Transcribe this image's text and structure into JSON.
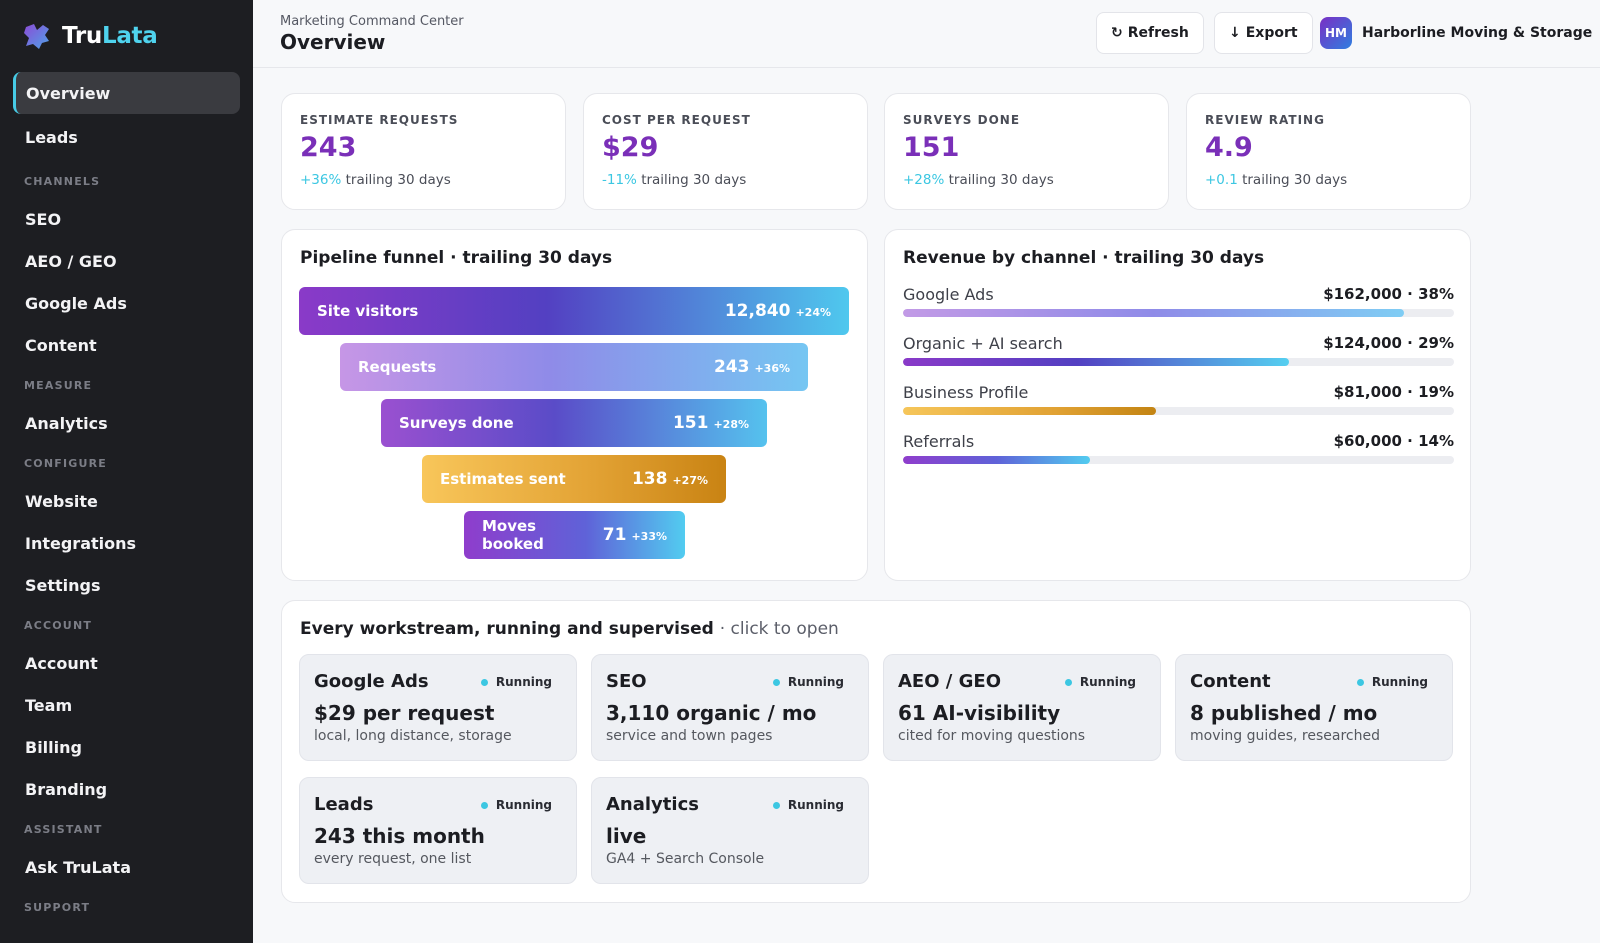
{
  "app": {
    "brand_part1": "Tru",
    "brand_part2": "Lata"
  },
  "sidebar": {
    "items": [
      {
        "label": "Overview",
        "active": true
      },
      {
        "label": "Leads"
      }
    ],
    "sections": [
      {
        "title": "CHANNELS",
        "items": [
          "SEO",
          "AEO / GEO",
          "Google Ads",
          "Content"
        ]
      },
      {
        "title": "MEASURE",
        "items": [
          "Analytics"
        ]
      },
      {
        "title": "CONFIGURE",
        "items": [
          "Website",
          "Integrations",
          "Settings"
        ]
      },
      {
        "title": "ACCOUNT",
        "items": [
          "Account",
          "Team",
          "Billing",
          "Branding"
        ]
      },
      {
        "title": "ASSISTANT",
        "items": [
          "Ask TruLata"
        ]
      },
      {
        "title": "SUPPORT",
        "items": []
      }
    ]
  },
  "header": {
    "eyebrow": "Marketing Command Center",
    "title": "Overview",
    "refresh_label": "Refresh",
    "export_label": "Export",
    "org_initials": "HM",
    "org_name": "Harborline Moving & Storage"
  },
  "kpis": [
    {
      "label": "ESTIMATE REQUESTS",
      "value": "243",
      "delta": "+36%",
      "sub": "trailing 30 days"
    },
    {
      "label": "COST PER REQUEST",
      "value": "$29",
      "delta": "-11%",
      "sub": "trailing 30 days"
    },
    {
      "label": "SURVEYS DONE",
      "value": "151",
      "delta": "+28%",
      "sub": "trailing 30 days"
    },
    {
      "label": "REVIEW RATING",
      "value": "4.9",
      "delta": "+0.1",
      "sub": "trailing 30 days"
    }
  ],
  "funnel": {
    "title": "Pipeline funnel · trailing 30 days",
    "stages": [
      {
        "label": "Site visitors",
        "value": "12,840",
        "delta": "+24%"
      },
      {
        "label": "Requests",
        "value": "243",
        "delta": "+36%"
      },
      {
        "label": "Surveys done",
        "value": "151",
        "delta": "+28%"
      },
      {
        "label": "Estimates sent",
        "value": "138",
        "delta": "+27%"
      },
      {
        "label": "Moves booked",
        "value": "71",
        "delta": "+33%"
      }
    ]
  },
  "revenue": {
    "title": "Revenue by channel · trailing 30 days",
    "rows": [
      {
        "name": "Google Ads",
        "amount": "$162,000 · 38%",
        "share": 0.91
      },
      {
        "name": "Organic + AI search",
        "amount": "$124,000 · 29%",
        "share": 0.7
      },
      {
        "name": "Business Profile",
        "amount": "$81,000 · 19%",
        "share": 0.46
      },
      {
        "name": "Referrals",
        "amount": "$60,000 · 14%",
        "share": 0.34
      }
    ]
  },
  "workstreams": {
    "title": "Every workstream, running and supervised",
    "hint": "· click to open",
    "items": [
      {
        "name": "Google Ads",
        "status": "Running",
        "metric": "$29 per request",
        "desc": "local, long distance, storage"
      },
      {
        "name": "SEO",
        "status": "Running",
        "metric": "3,110 organic / mo",
        "desc": "service and town pages"
      },
      {
        "name": "AEO / GEO",
        "status": "Running",
        "metric": "61 AI-visibility",
        "desc": "cited for moving questions"
      },
      {
        "name": "Content",
        "status": "Running",
        "metric": "8 published / mo",
        "desc": "moving guides, researched"
      },
      {
        "name": "Leads",
        "status": "Running",
        "metric": "243 this month",
        "desc": "every request, one list"
      },
      {
        "name": "Analytics",
        "status": "Running",
        "metric": "live",
        "desc": "GA4 + Search Console"
      }
    ]
  },
  "colors": {
    "accent": "#7a2fb8",
    "cyan": "#3cc7e2",
    "sidebar_bg": "#1d1e22"
  }
}
